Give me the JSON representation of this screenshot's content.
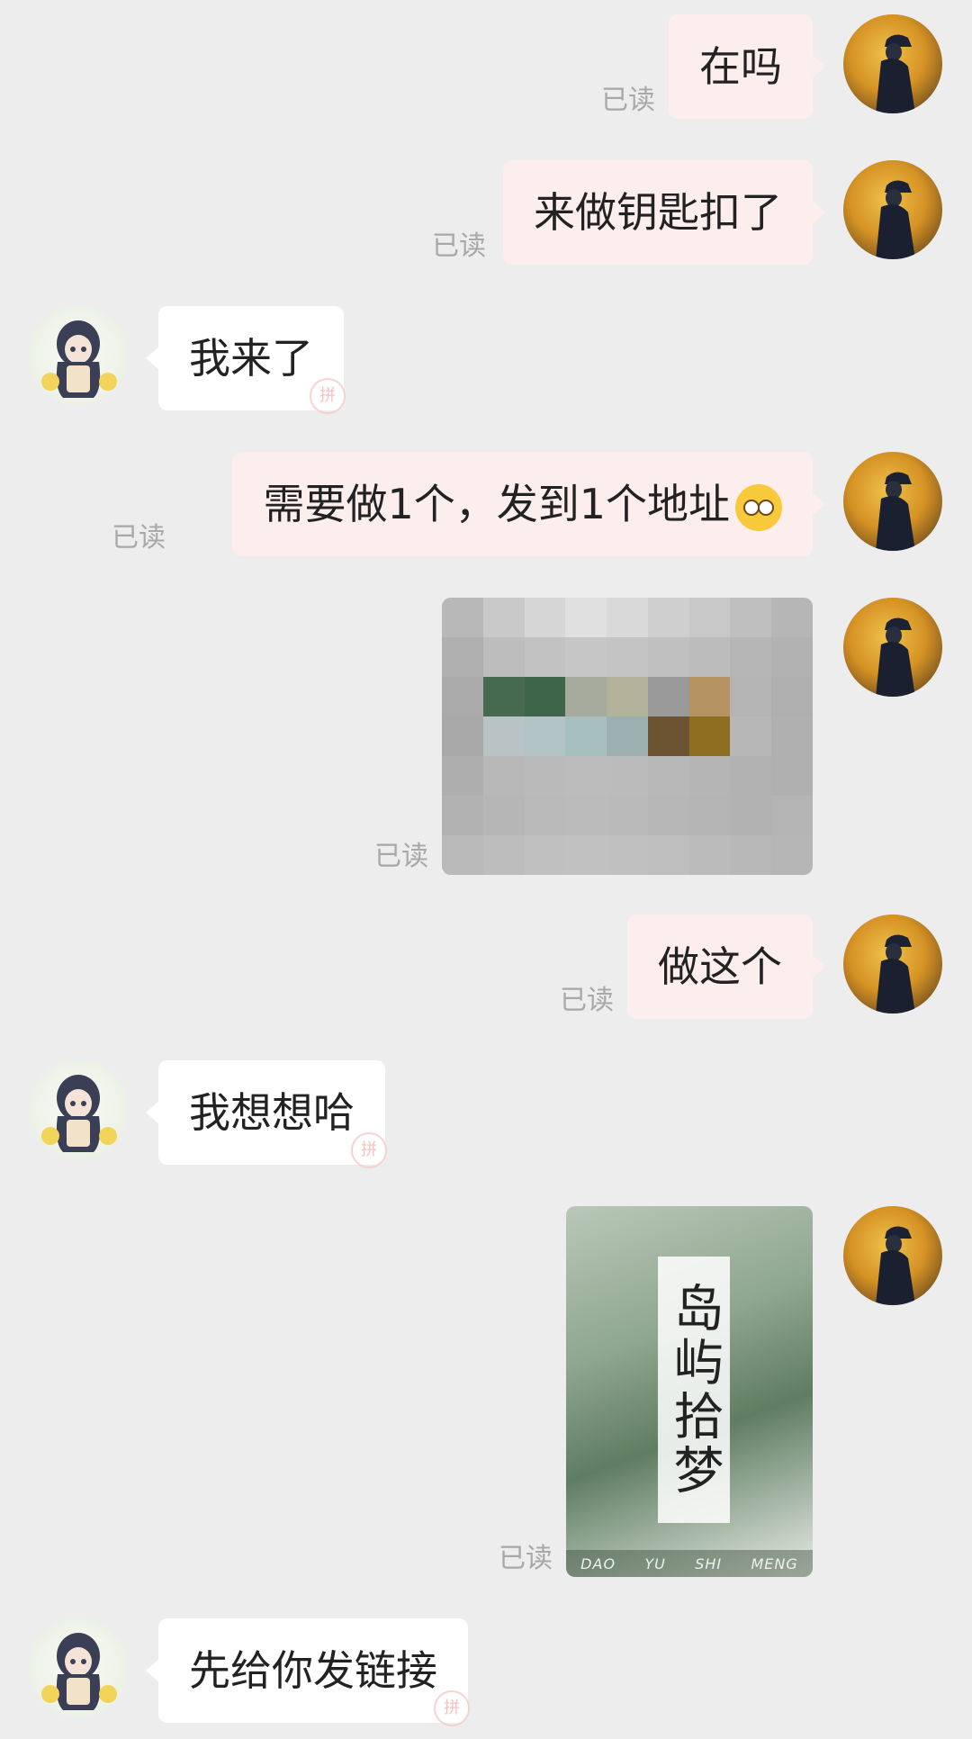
{
  "read_label": "已读",
  "stamp_char": "拼",
  "messages": [
    {
      "text": "在吗"
    },
    {
      "text": "来做钥匙扣了"
    },
    {
      "text": "我来了"
    },
    {
      "text": "需要做1个，发到1个地址"
    },
    {
      "text": "做这个"
    },
    {
      "text": "我想想哈"
    },
    {
      "text": "先给你发链接"
    }
  ],
  "cover_image": {
    "title": "岛屿拾梦",
    "pinyin": [
      "DAO",
      "YU",
      "SHI",
      "MENG"
    ]
  }
}
